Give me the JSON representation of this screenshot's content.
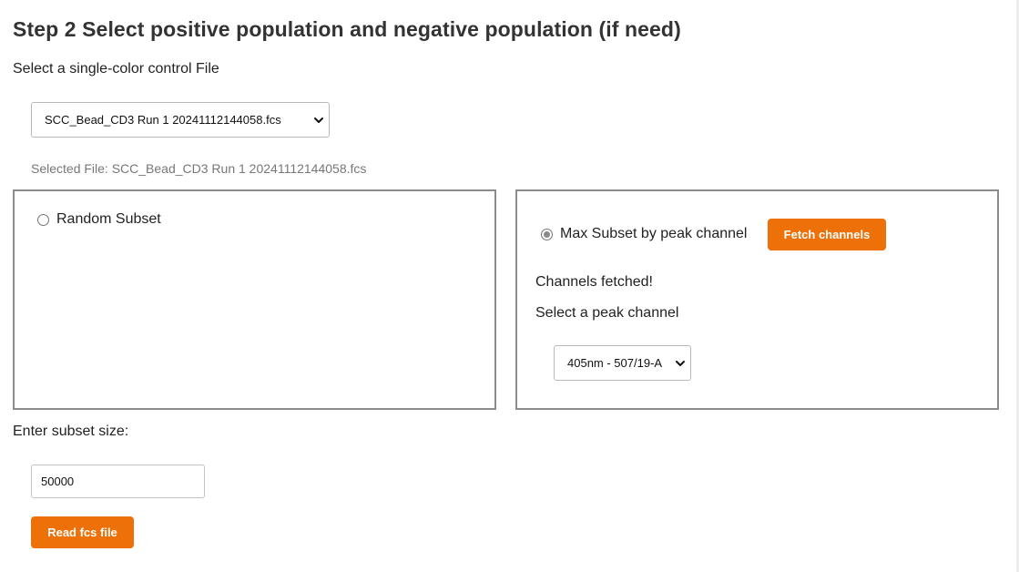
{
  "step_title": "Step 2 Select positive population and negative population (if need)",
  "control_file": {
    "label": "Select a single-color control File",
    "selected_value": "SCC_Bead_CD3 Run 1 20241112144058.fcs",
    "selected_text": "Selected File: SCC_Bead_CD3 Run 1 20241112144058.fcs"
  },
  "random_subset": {
    "label": "Random Subset",
    "checked": false
  },
  "max_subset": {
    "label": "Max Subset by peak channel",
    "checked": true,
    "fetch_button": "Fetch channels",
    "status": "Channels fetched!",
    "peak_label": "Select a peak channel",
    "peak_channel_value": "405nm - 507/19-A"
  },
  "subset_size": {
    "label": "Enter subset size:",
    "value": "50000"
  },
  "read_button": "Read fcs file",
  "colors": {
    "accent": "#ee7008",
    "panel_border": "#8c8c8c",
    "muted_text": "#777777"
  }
}
